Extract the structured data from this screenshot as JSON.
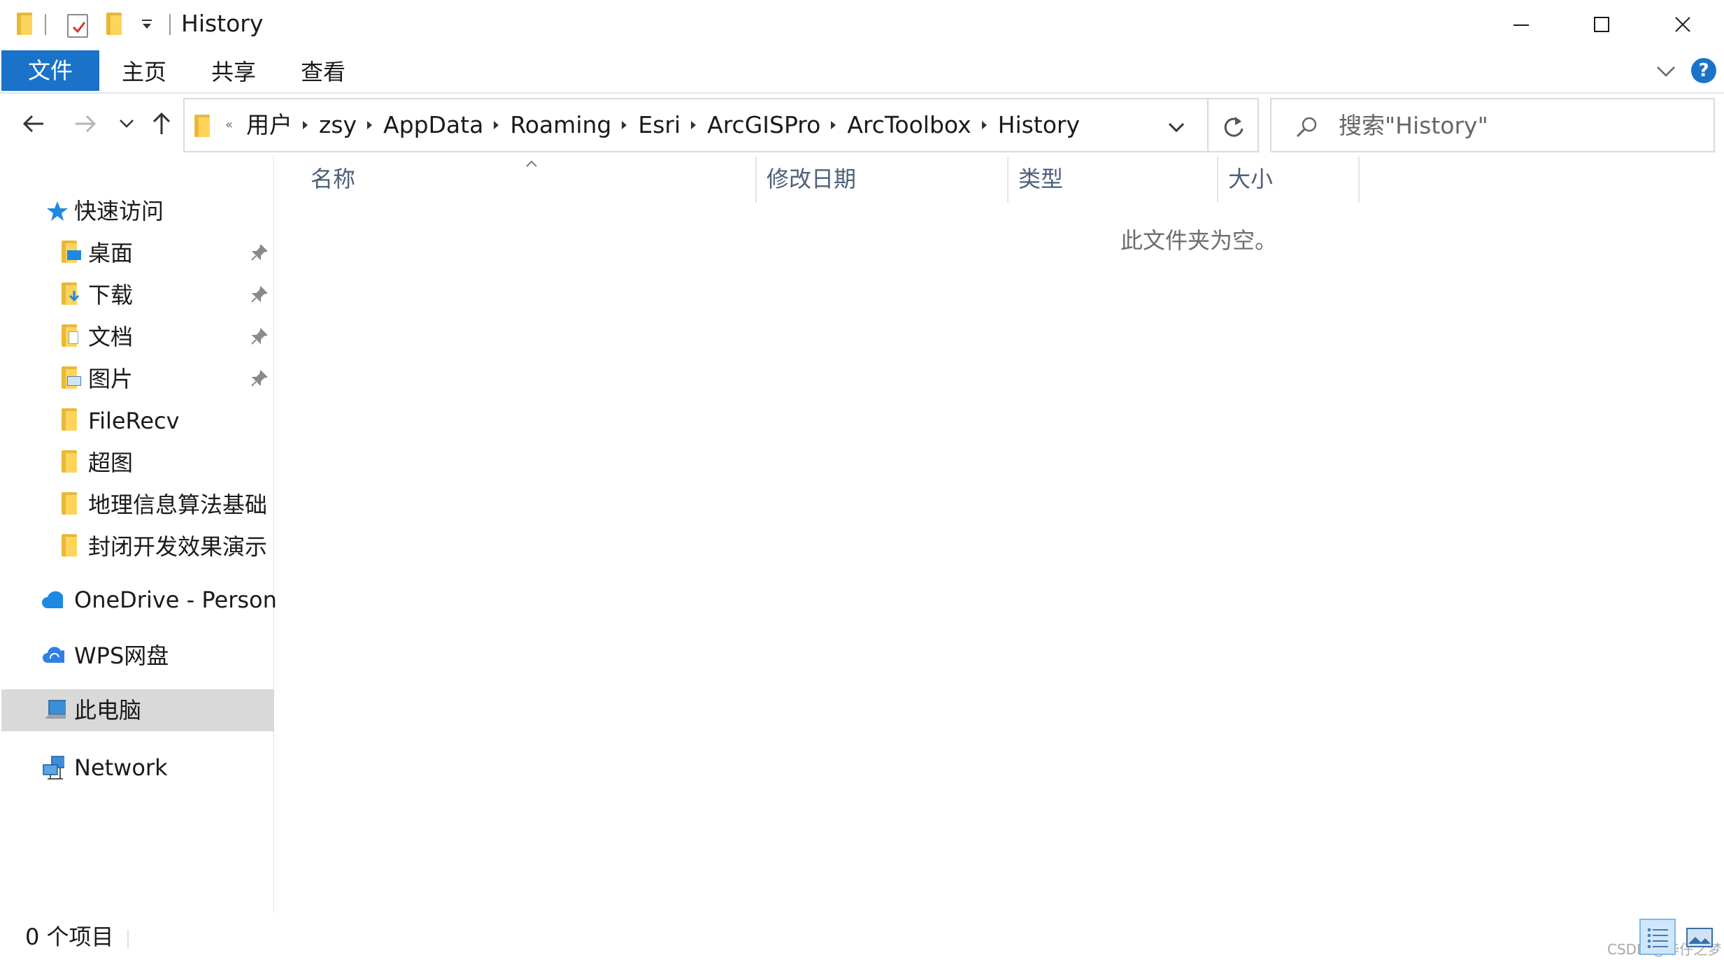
{
  "window": {
    "title": "History",
    "controls": {
      "minimize": "minimize-icon",
      "maximize": "maximize-icon",
      "close": "close-icon"
    }
  },
  "ribbon": {
    "tabs": [
      {
        "label": "文件",
        "active": true
      },
      {
        "label": "主页",
        "active": false
      },
      {
        "label": "共享",
        "active": false
      },
      {
        "label": "查看",
        "active": false
      }
    ],
    "help_label": "?"
  },
  "address": {
    "overflow": "«",
    "breadcrumbs": [
      "用户",
      "zsy",
      "AppData",
      "Roaming",
      "Esri",
      "ArcGISPro",
      "ArcToolbox",
      "History"
    ]
  },
  "search": {
    "placeholder": "搜索\"History\""
  },
  "sidebar": {
    "quick_access": {
      "label": "快速访问"
    },
    "items": [
      {
        "label": "桌面",
        "pinned": true
      },
      {
        "label": "下载",
        "pinned": true
      },
      {
        "label": "文档",
        "pinned": true
      },
      {
        "label": "图片",
        "pinned": true
      },
      {
        "label": "FileRecv",
        "pinned": false
      },
      {
        "label": "超图",
        "pinned": false
      },
      {
        "label": "地理信息算法基础",
        "pinned": false
      },
      {
        "label": "封闭开发效果演示",
        "pinned": false
      }
    ],
    "onedrive": {
      "label": "OneDrive - Personal"
    },
    "wps": {
      "label": "WPS网盘"
    },
    "this_pc": {
      "label": "此电脑",
      "selected": true
    },
    "network": {
      "label": "Network"
    }
  },
  "content": {
    "columns": [
      "名称",
      "修改日期",
      "类型",
      "大小"
    ],
    "empty_message": "此文件夹为空。"
  },
  "status": {
    "item_count": "0 个项目",
    "watermark": "CSDN @华仔之梦"
  },
  "colors": {
    "accent": "#1a73c9",
    "folder": "#ffd45a",
    "selection": "#d9d9d9",
    "column_header_text": "#4c607a"
  }
}
